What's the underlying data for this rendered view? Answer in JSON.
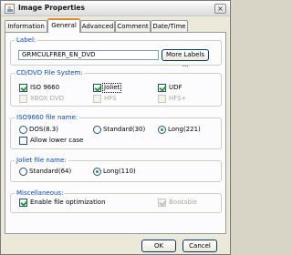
{
  "window": {
    "title": "Image Properties",
    "close_glyph": "×"
  },
  "tabs": [
    {
      "label": "Information",
      "active": false
    },
    {
      "label": "General",
      "active": true
    },
    {
      "label": "Advanced",
      "active": false
    },
    {
      "label": "Comment",
      "active": false
    },
    {
      "label": "Date/Time",
      "active": false
    }
  ],
  "label_group": {
    "legend": "Label:",
    "value": "GRMCULFRER_EN_DVD",
    "more_button": "More Labels ..."
  },
  "filesystem": {
    "legend": "CD/DVD File System:",
    "options": [
      {
        "label": "ISO 9660",
        "checked": true,
        "enabled": true
      },
      {
        "label": "Joliet",
        "checked": true,
        "enabled": true
      },
      {
        "label": "UDF",
        "checked": true,
        "enabled": true
      },
      {
        "label": "XBOX DVD",
        "checked": false,
        "enabled": false
      },
      {
        "label": "HFS",
        "checked": false,
        "enabled": false
      },
      {
        "label": "HFS+",
        "checked": false,
        "enabled": false
      }
    ]
  },
  "iso_name": {
    "legend": "ISO9660 file name:",
    "options": [
      {
        "label": "DOS(8.3)",
        "selected": false
      },
      {
        "label": "Standard(30)",
        "selected": false
      },
      {
        "label": "Long(221)",
        "selected": true
      }
    ],
    "allow_lower": {
      "label": "Allow lower case",
      "checked": false
    }
  },
  "joliet_name": {
    "legend": "Joliet file name:",
    "options": [
      {
        "label": "Standard(64)",
        "selected": false
      },
      {
        "label": "Long(110)",
        "selected": true
      }
    ]
  },
  "misc": {
    "legend": "Miscellaneous:",
    "optimize": {
      "label": "Enable file optimization",
      "checked": true
    },
    "bootable": {
      "label": "Bootable",
      "checked": true,
      "enabled": false
    }
  },
  "footer": {
    "ok": "OK",
    "cancel": "Cancel"
  },
  "colors": {
    "legend": "#0046d5",
    "active_tab": "#e68b2c",
    "check": "#21a121"
  },
  "icons": {
    "app": "image-properties-icon",
    "close": "close-icon"
  }
}
